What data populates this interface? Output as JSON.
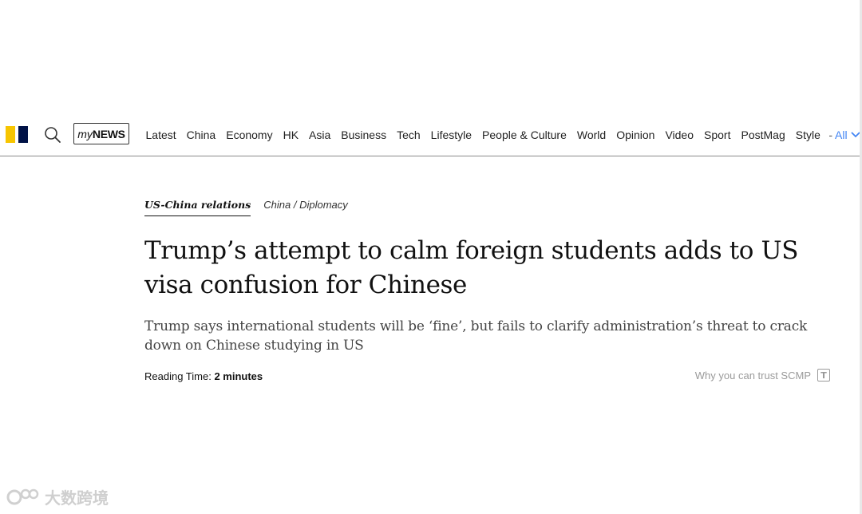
{
  "nav": {
    "mynews": {
      "my": "my",
      "news": "NEWS"
    },
    "items": [
      {
        "label": "Latest"
      },
      {
        "label": "China"
      },
      {
        "label": "Economy"
      },
      {
        "label": "HK"
      },
      {
        "label": "Asia"
      },
      {
        "label": "Business"
      },
      {
        "label": "Tech"
      },
      {
        "label": "Lifestyle"
      },
      {
        "label": "People & Culture"
      },
      {
        "label": "World"
      },
      {
        "label": "Opinion"
      },
      {
        "label": "Video"
      },
      {
        "label": "Sport"
      },
      {
        "label": "PostMag"
      },
      {
        "label": "Style"
      }
    ],
    "separator": "-",
    "all_label": "All",
    "icons": {
      "search": "search-icon",
      "all_chevron": "chevron-down-icon"
    },
    "colors": {
      "logo_yellow": "#f7c500",
      "logo_navy": "#001246",
      "all_link": "#4285f4"
    }
  },
  "article": {
    "topic_primary": "US-China relations",
    "topic_secondary": "China / Diplomacy",
    "headline": "Trump’s attempt to calm foreign students adds to US visa confusion for Chinese",
    "subheadline": "Trump says international students will be ‘fine’, but fails to clarify administration’s threat to crack down on Chinese studying in US",
    "reading_time_label": "Reading Time:",
    "reading_time_value": "2 minutes",
    "trust_label": "Why you can trust SCMP",
    "trust_icon": "T"
  },
  "watermark": {
    "text": "大数跨境"
  }
}
